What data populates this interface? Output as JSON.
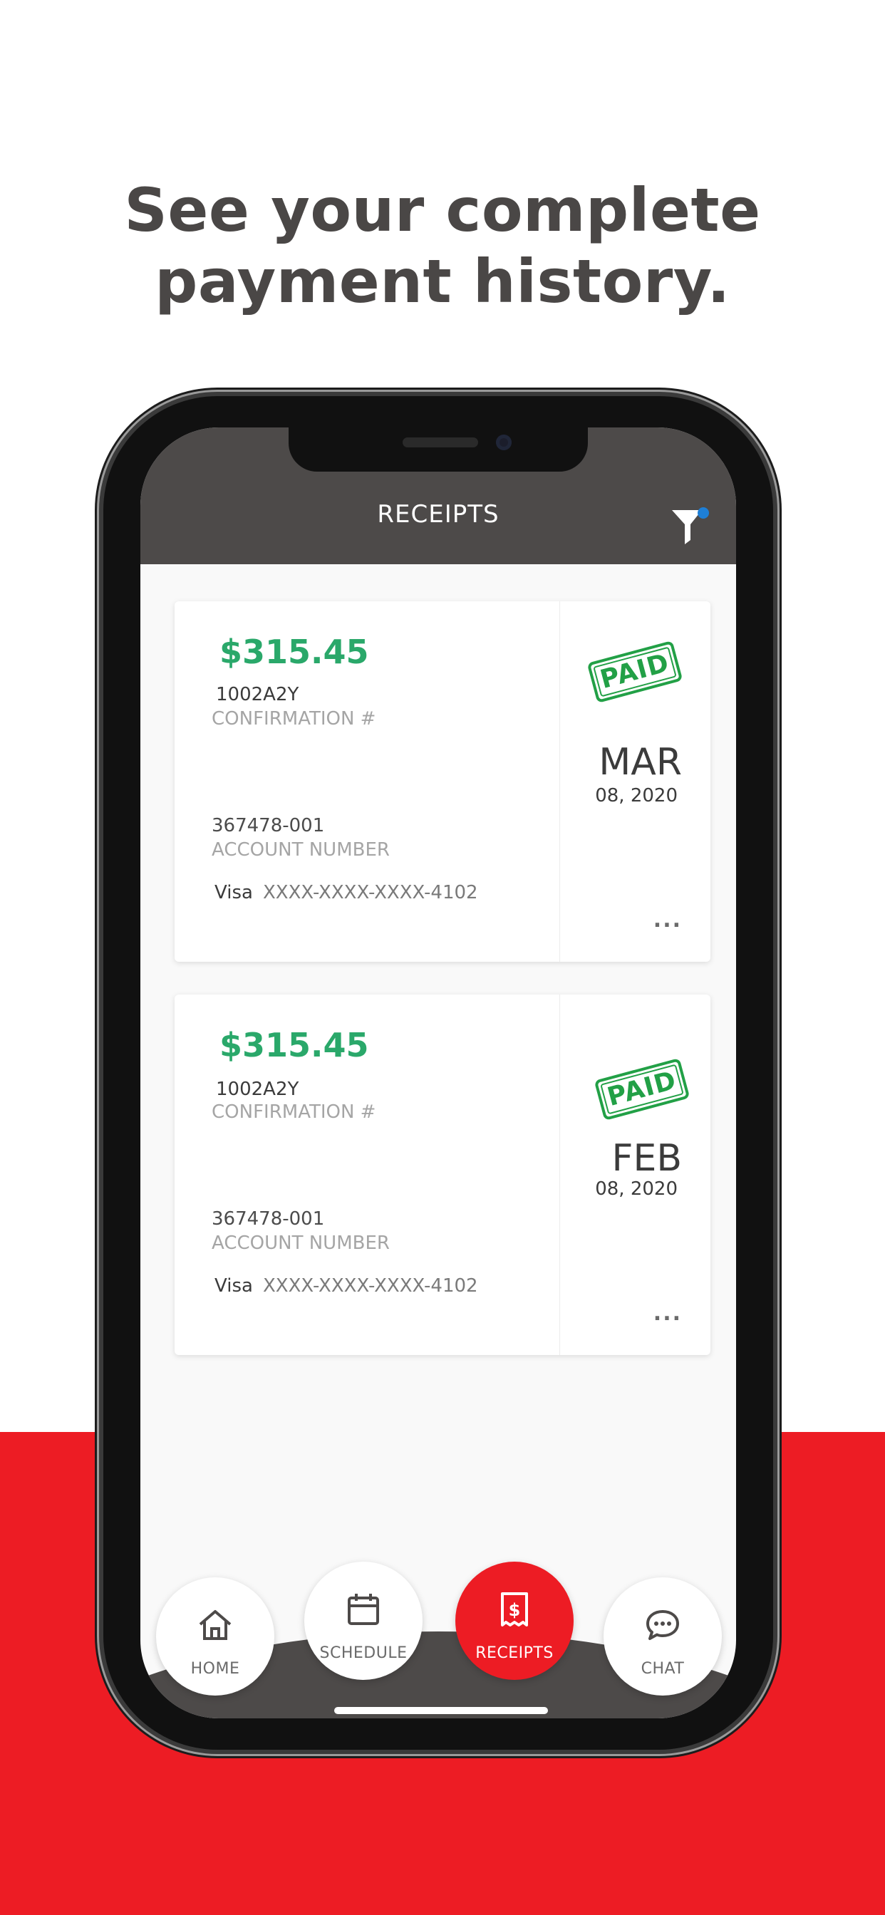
{
  "promo": {
    "headline_line1": "See your complete",
    "headline_line2": "payment history."
  },
  "app": {
    "header_title": "RECEIPTS",
    "filter_icon": "filter-icon",
    "filter_badge_color": "#1e7fd6"
  },
  "receipts": [
    {
      "amount": "$315.45",
      "confirmation_number": "1002A2Y",
      "confirmation_label": "CONFIRMATION #",
      "account_number": "367478-001",
      "account_label": "ACCOUNT NUMBER",
      "card_brand": "Visa",
      "card_number": "XXXX-XXXX-XXXX-4102",
      "status": "PAID",
      "month": "MAR",
      "day_year": "08, 2020",
      "more": "..."
    },
    {
      "amount": "$315.45",
      "confirmation_number": "1002A2Y",
      "confirmation_label": "CONFIRMATION #",
      "account_number": "367478-001",
      "account_label": "ACCOUNT NUMBER",
      "card_brand": "Visa",
      "card_number": "XXXX-XXXX-XXXX-4102",
      "status": "PAID",
      "month": "FEB",
      "day_year": "08, 2020",
      "more": "..."
    }
  ],
  "nav": {
    "items": [
      {
        "label": "HOME",
        "icon": "home-icon",
        "active": false
      },
      {
        "label": "SCHEDULE",
        "icon": "calendar-icon",
        "active": false
      },
      {
        "label": "RECEIPTS",
        "icon": "receipt-icon",
        "active": true
      },
      {
        "label": "CHAT",
        "icon": "chat-icon",
        "active": false
      }
    ]
  },
  "colors": {
    "brand_red": "#ed1c24",
    "header_gray": "#4d4a49",
    "amount_green": "#2aa86a",
    "paid_green": "#22a046"
  }
}
